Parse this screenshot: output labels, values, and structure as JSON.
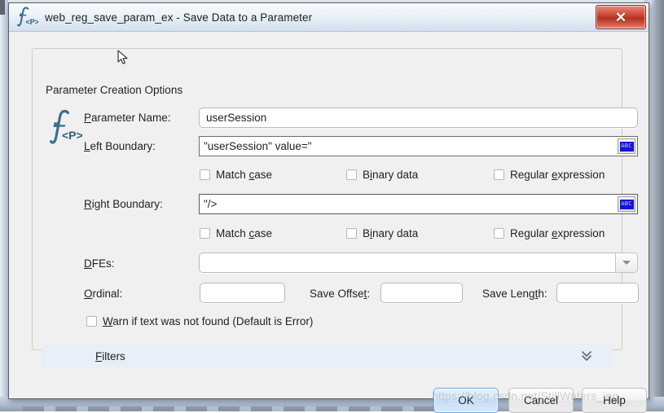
{
  "window": {
    "title": "web_reg_save_param_ex - Save Data to a Parameter",
    "icon": "function-parameter-icon",
    "close_label": "✕"
  },
  "group": {
    "legend": "Parameter Creation Options",
    "icon": "function-parameter-icon"
  },
  "fields": {
    "parameter_name": {
      "label_pre": "P",
      "label_post": "arameter Name:",
      "value": "userSession"
    },
    "left_boundary": {
      "label_pre": "L",
      "label_post": "eft Boundary:",
      "value": "\"userSession\" value=\"",
      "helper_icon": "abc-icon",
      "helper_text": "ABC"
    },
    "right_boundary": {
      "label_pre": "R",
      "label_post": "ight Boundary:",
      "value": "\"/>",
      "helper_icon": "abc-icon",
      "helper_text": "ABC"
    },
    "dfes": {
      "label_pre": "D",
      "label_post": "FEs:",
      "value": "",
      "dropdown_icon": "chevron-down-icon"
    },
    "ordinal": {
      "label_pre": "O",
      "label_post": "rdinal:",
      "value": ""
    },
    "save_offset": {
      "label_a": "Save Offse",
      "label_mn": "t",
      "label_b": ":",
      "value": ""
    },
    "save_length": {
      "label_a": "Save Leng",
      "label_mn": "t",
      "label_b": "h:",
      "value": ""
    }
  },
  "left_boundary_options": [
    {
      "pre": "Match ",
      "mn": "c",
      "post": "ase",
      "checked": false
    },
    {
      "pre": "B",
      "mn": "i",
      "post": "nary data",
      "checked": false
    },
    {
      "pre": "Regular ",
      "mn": "e",
      "post": "xpression",
      "checked": false
    }
  ],
  "right_boundary_options": [
    {
      "pre": "Match ",
      "mn": "c",
      "post": "ase",
      "checked": false
    },
    {
      "pre": "B",
      "mn": "i",
      "post": "nary data",
      "checked": false
    },
    {
      "pre": "Regular ",
      "mn": "e",
      "post": "xpression",
      "checked": false
    }
  ],
  "warn_option": {
    "pre": "",
    "mn": "W",
    "post": "arn if text was not found (Default is Error)",
    "checked": false
  },
  "filters": {
    "label_pre": "F",
    "label_post": "ilters",
    "expander_icon": "double-chevron-down-icon"
  },
  "buttons": {
    "ok": "OK",
    "cancel": "Cancel",
    "help": "Help"
  },
  "watermark": "https://blog.csdn.net/StillWaters_ing",
  "colors": {
    "dialog_bg": "#f0f0f0",
    "titlebar": "#e3ecf5",
    "close_red": "#c33b28",
    "default_button_blue": "#c7dcf5",
    "filters_bar": "#e8eff7",
    "abc_blue": "#1414cf",
    "icon_teal": "#3d6f8e"
  }
}
